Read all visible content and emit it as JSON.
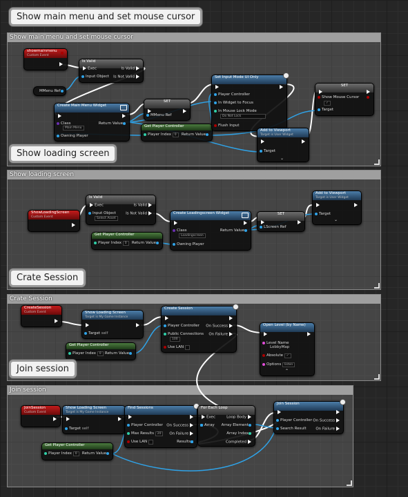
{
  "labels": {
    "main": "Show main menu and set mouse cursor",
    "loading": "Show loading screen",
    "crate": "Crate Session",
    "join": "Join session"
  },
  "comments": {
    "main": "Show main menu and set mouse cursor",
    "loading": "Show loading screen",
    "crate": "Crate Session",
    "join": "Join session"
  },
  "g1": {
    "event": {
      "title": "showmainmenu",
      "sub": "Custom Event"
    },
    "isvalid": {
      "title": "Is Valid",
      "exec": "Exec",
      "input": "Input Object",
      "isvalid": "Is Valid",
      "notvalid": "Is Not Valid"
    },
    "mmenuref": "MMenu Ref",
    "create": {
      "title": "Create Main Menu Widget",
      "class": "Class",
      "class_val": "Main Menu",
      "owning": "Owning Player",
      "ret": "Return Value"
    },
    "set": {
      "title": "SET",
      "var": "MMenu Ref"
    },
    "getpc": {
      "title": "Get Player Controller",
      "index": "Player Index",
      "index_val": "0",
      "ret": "Return Value"
    },
    "inputmode": {
      "title": "Set Input Mode UI Only",
      "pc": "Player Controller",
      "focus": "In Widget to Focus",
      "lock": "In Mouse Lock Mode",
      "lock_val": "Do Not Lock",
      "flush": "Flush Input"
    },
    "addvp": {
      "title": "Add to Viewport",
      "sub": "Target is User Widget",
      "target": "Target"
    },
    "setcursor": {
      "title": "SET",
      "show": "Show Mouse Cursor",
      "target": "Target"
    }
  },
  "g2": {
    "event": {
      "title": "ShowLoadingScreen",
      "sub": "Custom Event"
    },
    "isvalid": {
      "title": "Is Valid",
      "exec": "Exec",
      "input": "Input Object",
      "input_val": "Select Asset",
      "isvalid": "Is Valid",
      "notvalid": "Is Not Valid"
    },
    "create": {
      "title": "Create Loadingscreen Widget",
      "class": "Class",
      "class_val": "Loadingscreen",
      "owning": "Owning Player",
      "ret": "Return Value"
    },
    "set": {
      "title": "SET",
      "var": "LScreen Ref"
    },
    "getpc": {
      "title": "Get Player Controller",
      "index": "Player Index",
      "index_val": "0",
      "ret": "Return Value"
    },
    "addvp": {
      "title": "Add to Viewport",
      "sub": "Target is User Widget",
      "target": "Target"
    }
  },
  "g3": {
    "event": {
      "title": "CreateSession",
      "sub": "Custom Event"
    },
    "showload": {
      "title": "Show Loading Screen",
      "sub": "Target is My Game Instance",
      "target": "Target",
      "target_val": "self"
    },
    "getpc": {
      "title": "Get Player Controller",
      "index": "Player Index",
      "index_val": "0",
      "ret": "Return Value"
    },
    "create": {
      "title": "Create Session",
      "pc": "Player Controller",
      "conn": "Public Connections",
      "conn_val": "100",
      "lan": "Use LAN",
      "success": "On Success",
      "failure": "On Failure"
    },
    "openlevel": {
      "title": "Open Level (by Name)",
      "level": "Level Name",
      "level_val": "LobbyMap",
      "absolute": "Absolute",
      "options": "Options",
      "options_val": "listen"
    }
  },
  "g4": {
    "event": {
      "title": "JoinSession",
      "sub": "Custom Event"
    },
    "showload": {
      "title": "Show Loading Screen",
      "sub": "Target is My Game Instance",
      "target": "Target",
      "target_val": "self"
    },
    "getpc": {
      "title": "Get Player Controller",
      "index": "Player Index",
      "index_val": "0",
      "ret": "Return Value"
    },
    "find": {
      "title": "Find Sessions",
      "pc": "Player Controller",
      "max": "Max Results",
      "max_val": "20",
      "lan": "Use LAN",
      "success": "On Success",
      "failure": "On Failure",
      "results": "Results"
    },
    "foreach": {
      "title": "For Each Loop",
      "exec": "Exec",
      "array": "Array",
      "body": "Loop Body",
      "element": "Array Element",
      "index": "Array Index",
      "completed": "Completed"
    },
    "join": {
      "title": "Join Session",
      "pc": "Player Controller",
      "search": "Search Result",
      "success": "On Success",
      "failure": "On Failure"
    }
  }
}
